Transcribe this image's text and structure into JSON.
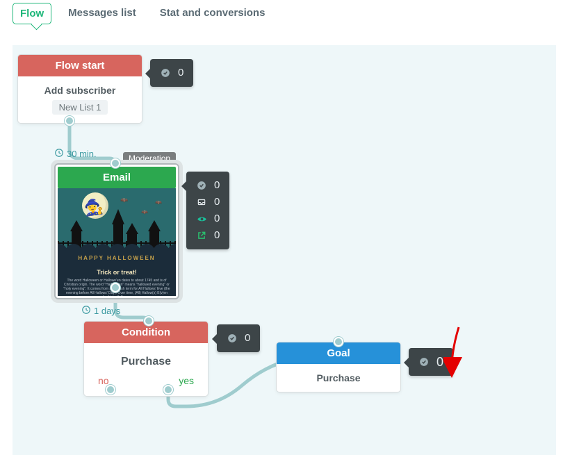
{
  "tabs": {
    "flow": "Flow",
    "messages": "Messages list",
    "stats": "Stat and conversions"
  },
  "nodes": {
    "start": {
      "title": "Flow start",
      "action": "Add subscriber",
      "list": "New List 1"
    },
    "email": {
      "title": "Email",
      "delay": "30 min.",
      "moderation_tag": "Moderation",
      "thumb": {
        "banner": "HAPPY HALLOWEEN",
        "title": "Trick or treat!",
        "body": "The word Halloween or Hallowe'en dates to about 1745 and is of Christian origin. The word \"Hallowe'en\" means \"hallowed evening\" or \"holy evening\". It comes from a Scottish term for All Hallows' Eve (the evening before All Hallows' Day). Over time, (All) Hallow(s) E(v)en evolved into Halloween…"
      },
      "stats": {
        "sent": "0",
        "delivered": "0",
        "opened": "0",
        "clicked": "0"
      }
    },
    "condition": {
      "title": "Condition",
      "label": "Purchase",
      "delay": "1 days",
      "no": "no",
      "yes": "yes",
      "stats": {
        "count": "0"
      }
    },
    "goal": {
      "title": "Goal",
      "label": "Purchase",
      "stats": {
        "count": "0"
      }
    }
  },
  "start_stats": {
    "count": "0"
  }
}
